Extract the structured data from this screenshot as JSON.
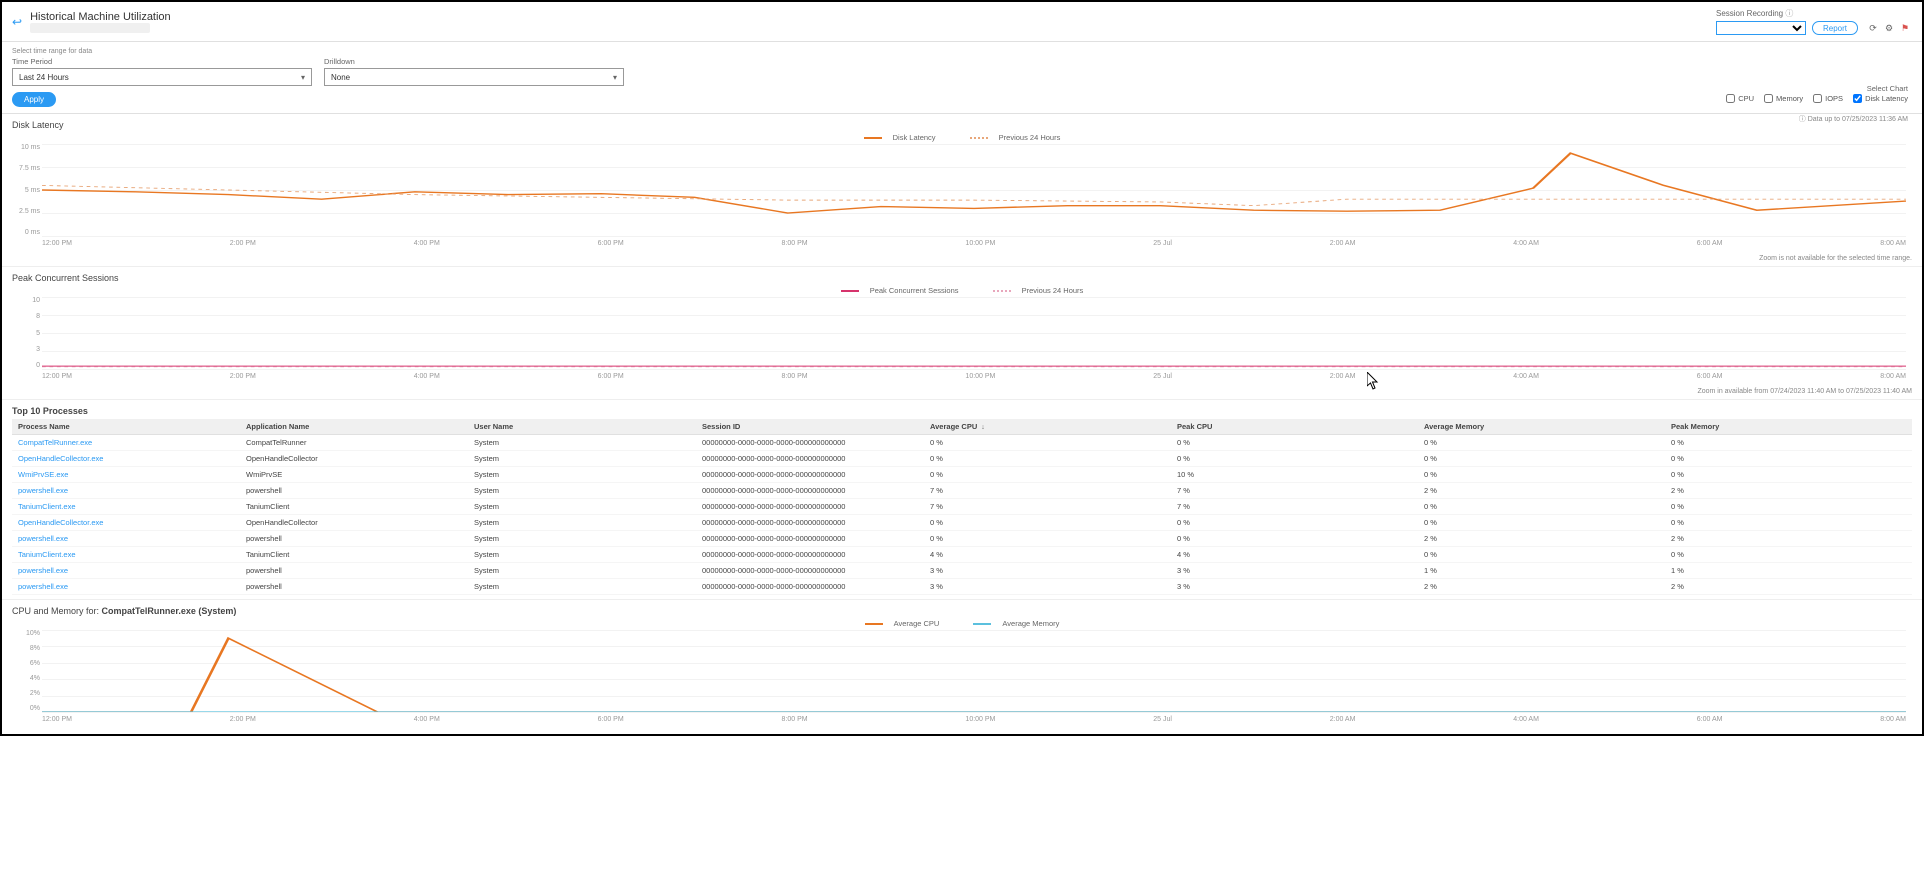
{
  "header": {
    "title": "Historical Machine Utilization",
    "session_recording_label": "Session Recording",
    "session_select_value": "",
    "report_button": "Report",
    "data_note": "Data up to 07/25/2023 11:36 AM"
  },
  "filters": {
    "hint": "Select time range for data",
    "time_label": "Time Period",
    "time_value": "Last 24 Hours",
    "drilldown_label": "Drilldown",
    "drilldown_value": "None",
    "apply": "Apply"
  },
  "chart_selector": {
    "label": "Select Chart",
    "cpu": "CPU",
    "memory": "Memory",
    "iops": "IOPS",
    "disk_latency": "Disk Latency",
    "cpu_checked": false,
    "memory_checked": false,
    "iops_checked": false,
    "disk_latency_checked": true
  },
  "disk_latency": {
    "title": "Disk Latency",
    "legend_current": "Disk Latency",
    "legend_prev": "Previous 24 Hours",
    "zoom_note": "Zoom is not available for the selected time range."
  },
  "sessions": {
    "title": "Peak Concurrent Sessions",
    "legend_current": "Peak Concurrent Sessions",
    "legend_prev": "Previous 24 Hours",
    "zoom_note": "Zoom in available from 07/24/2023 11:40 AM to 07/25/2023 11:40 AM"
  },
  "top_processes": {
    "title": "Top 10 Processes",
    "columns": {
      "process_name": "Process Name",
      "application_name": "Application Name",
      "user_name": "User Name",
      "session_id": "Session ID",
      "avg_cpu": "Average CPU",
      "peak_cpu": "Peak CPU",
      "avg_mem": "Average Memory",
      "peak_mem": "Peak Memory"
    },
    "rows": [
      {
        "proc": "CompatTelRunner.exe",
        "app": "CompatTelRunner",
        "user": "System",
        "sid": "00000000-0000-0000-0000-000000000000",
        "avg_cpu": "0 %",
        "peak_cpu": "0 %",
        "avg_mem": "0 %",
        "peak_mem": "0 %"
      },
      {
        "proc": "OpenHandleCollector.exe",
        "app": "OpenHandleCollector",
        "user": "System",
        "sid": "00000000-0000-0000-0000-000000000000",
        "avg_cpu": "0 %",
        "peak_cpu": "0 %",
        "avg_mem": "0 %",
        "peak_mem": "0 %"
      },
      {
        "proc": "WmiPrvSE.exe",
        "app": "WmiPrvSE",
        "user": "System",
        "sid": "00000000-0000-0000-0000-000000000000",
        "avg_cpu": "0 %",
        "peak_cpu": "10 %",
        "avg_mem": "0 %",
        "peak_mem": "0 %"
      },
      {
        "proc": "powershell.exe",
        "app": "powershell",
        "user": "System",
        "sid": "00000000-0000-0000-0000-000000000000",
        "avg_cpu": "7 %",
        "peak_cpu": "7 %",
        "avg_mem": "2 %",
        "peak_mem": "2 %"
      },
      {
        "proc": "TaniumClient.exe",
        "app": "TaniumClient",
        "user": "System",
        "sid": "00000000-0000-0000-0000-000000000000",
        "avg_cpu": "7 %",
        "peak_cpu": "7 %",
        "avg_mem": "0 %",
        "peak_mem": "0 %"
      },
      {
        "proc": "OpenHandleCollector.exe",
        "app": "OpenHandleCollector",
        "user": "System",
        "sid": "00000000-0000-0000-0000-000000000000",
        "avg_cpu": "0 %",
        "peak_cpu": "0 %",
        "avg_mem": "0 %",
        "peak_mem": "0 %"
      },
      {
        "proc": "powershell.exe",
        "app": "powershell",
        "user": "System",
        "sid": "00000000-0000-0000-0000-000000000000",
        "avg_cpu": "0 %",
        "peak_cpu": "0 %",
        "avg_mem": "2 %",
        "peak_mem": "2 %"
      },
      {
        "proc": "TaniumClient.exe",
        "app": "TaniumClient",
        "user": "System",
        "sid": "00000000-0000-0000-0000-000000000000",
        "avg_cpu": "4 %",
        "peak_cpu": "4 %",
        "avg_mem": "0 %",
        "peak_mem": "0 %"
      },
      {
        "proc": "powershell.exe",
        "app": "powershell",
        "user": "System",
        "sid": "00000000-0000-0000-0000-000000000000",
        "avg_cpu": "3 %",
        "peak_cpu": "3 %",
        "avg_mem": "1 %",
        "peak_mem": "1 %"
      },
      {
        "proc": "powershell.exe",
        "app": "powershell",
        "user": "System",
        "sid": "00000000-0000-0000-0000-000000000000",
        "avg_cpu": "3 %",
        "peak_cpu": "3 %",
        "avg_mem": "2 %",
        "peak_mem": "2 %"
      }
    ]
  },
  "cpu_mem": {
    "title_prefix": "CPU and Memory for: ",
    "title_target": "CompatTelRunner.exe (System)",
    "legend_cpu": "Average CPU",
    "legend_mem": "Average Memory"
  },
  "x_ticks_main": [
    "12:00 PM",
    "2:00 PM",
    "4:00 PM",
    "6:00 PM",
    "8:00 PM",
    "10:00 PM",
    "25 Jul",
    "2:00 AM",
    "4:00 AM",
    "6:00 AM",
    "8:00 AM"
  ],
  "x_ticks_cpu": [
    "12:00 PM",
    "2:00 PM",
    "4:00 PM",
    "6:00 PM",
    "8:00 PM",
    "10:00 PM",
    "25 Jul",
    "2:00 AM",
    "4:00 AM",
    "6:00 AM",
    "8:00 AM"
  ],
  "y_ticks_disk": [
    "10 ms",
    "7.5 ms",
    "5 ms",
    "2.5 ms",
    "0 ms"
  ],
  "y_ticks_sessions": [
    "10",
    "8",
    "5",
    "3",
    "0"
  ],
  "y_ticks_cpu": [
    "10%",
    "8%",
    "6%",
    "4%",
    "2%",
    "0%"
  ],
  "chart_data": [
    {
      "name": "Disk Latency",
      "type": "line",
      "xlabel": "",
      "ylabel": "ms",
      "ylim": [
        0,
        10
      ],
      "categories": [
        "12:00 PM",
        "2:00 PM",
        "4:00 PM",
        "6:00 PM",
        "8:00 PM",
        "10:00 PM",
        "25 Jul",
        "2:00 AM",
        "4:00 AM",
        "6:00 AM",
        "8:00 AM"
      ],
      "series": [
        {
          "name": "Disk Latency",
          "values": [
            5,
            4.5,
            4,
            4.5,
            3,
            3.5,
            3.5,
            3,
            5,
            9.5,
            3.5
          ]
        },
        {
          "name": "Previous 24 Hours",
          "values": [
            5.5,
            5,
            4.5,
            4,
            4,
            4,
            3.5,
            3.5,
            4,
            4,
            4,
            4
          ]
        }
      ]
    },
    {
      "name": "Peak Concurrent Sessions",
      "type": "line",
      "xlabel": "",
      "ylabel": "sessions",
      "ylim": [
        0,
        10
      ],
      "categories": [
        "12:00 PM",
        "2:00 PM",
        "4:00 PM",
        "6:00 PM",
        "8:00 PM",
        "10:00 PM",
        "25 Jul",
        "2:00 AM",
        "4:00 AM",
        "6:00 AM",
        "8:00 AM"
      ],
      "series": [
        {
          "name": "Peak Concurrent Sessions",
          "values": [
            0.3,
            0.3,
            0.3,
            0.3,
            0.3,
            0.3,
            0.3,
            0.3,
            0.3,
            0.3,
            0.3
          ]
        },
        {
          "name": "Previous 24 Hours",
          "values": [
            0.3,
            0.3,
            0.3,
            0.3,
            0.3,
            0.3,
            0.3,
            0.3,
            0.3,
            0.3,
            0.3
          ]
        }
      ]
    },
    {
      "name": "CPU and Memory for CompatTelRunner.exe (System)",
      "type": "line",
      "xlabel": "",
      "ylabel": "%",
      "ylim": [
        0,
        10
      ],
      "categories": [
        "12:00 PM",
        "2:00 PM",
        "4:00 PM",
        "6:00 PM",
        "8:00 PM",
        "10:00 PM",
        "25 Jul",
        "2:00 AM",
        "4:00 AM",
        "6:00 AM",
        "8:00 AM"
      ],
      "series": [
        {
          "name": "Average CPU",
          "values": [
            0,
            9,
            0,
            0,
            0,
            0,
            0,
            0,
            0,
            0,
            0
          ]
        },
        {
          "name": "Average Memory",
          "values": [
            0,
            0,
            0,
            0,
            0,
            0,
            0,
            0,
            0,
            0,
            0
          ]
        }
      ]
    }
  ]
}
